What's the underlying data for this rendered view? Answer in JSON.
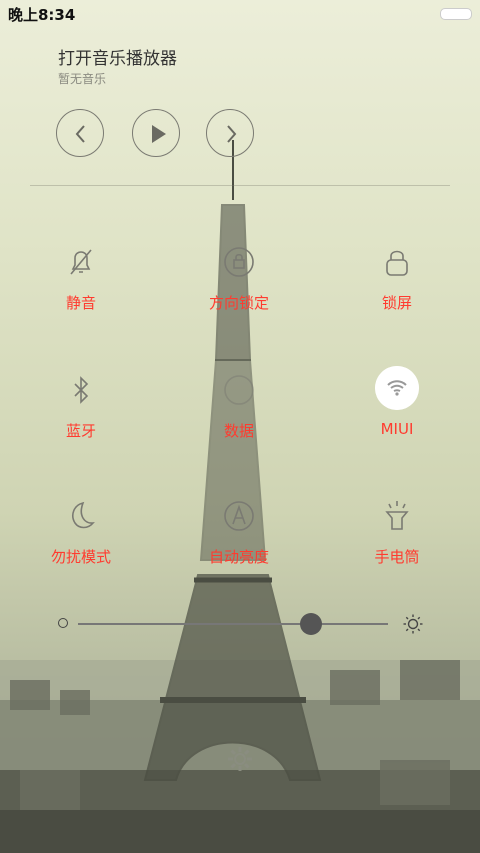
{
  "status_bar": {
    "time": "晚上8:34"
  },
  "music": {
    "title": "打开音乐播放器",
    "subtitle": "暂无音乐"
  },
  "media_controls": [
    "previous-icon",
    "play-icon",
    "next-icon"
  ],
  "toggles": [
    {
      "label": "静音",
      "icon": "bell-mute-icon"
    },
    {
      "label": "方向锁定",
      "icon": "rotation-lock-icon"
    },
    {
      "label": "锁屏",
      "icon": "lock-icon"
    },
    {
      "label": "蓝牙",
      "icon": "bluetooth-icon"
    },
    {
      "label": "数据",
      "icon": "data-icon"
    },
    {
      "label": "MIUI",
      "icon": "wifi-icon",
      "active": true
    },
    {
      "label": "勿扰模式",
      "icon": "moon-icon"
    },
    {
      "label": "自动亮度",
      "icon": "auto-brightness-icon"
    },
    {
      "label": "手电筒",
      "icon": "flashlight-icon"
    }
  ],
  "brightness": {
    "level": 0.75
  },
  "colors": {
    "label_red": "#ff3b2f",
    "icon_gray": "#7a7a72"
  }
}
